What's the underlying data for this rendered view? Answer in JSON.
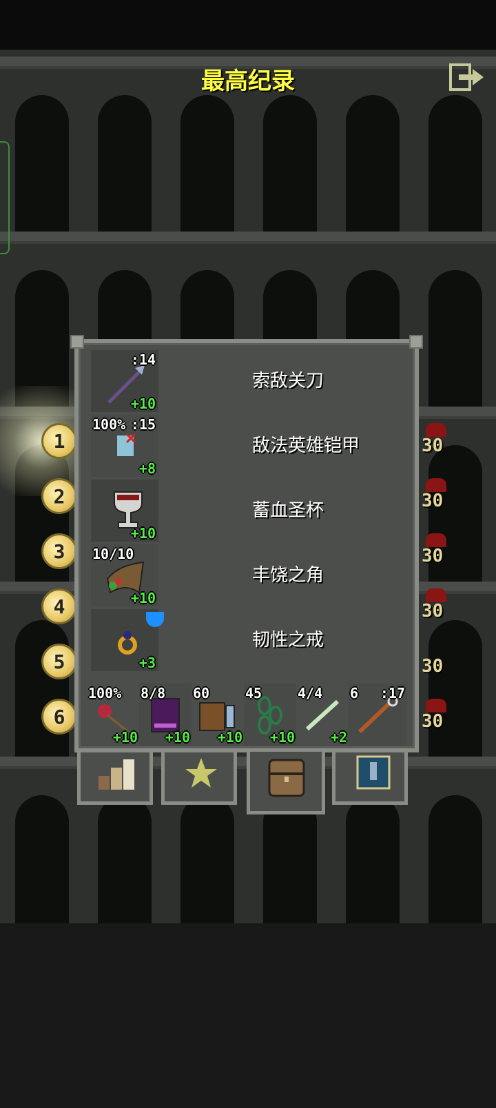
{
  "header": {
    "title": "最高纪录",
    "exit_icon": "exit-icon"
  },
  "ranks": [
    {
      "rank": "1",
      "score": "30",
      "highlight": true
    },
    {
      "rank": "2",
      "score": "30",
      "highlight": false
    },
    {
      "rank": "3",
      "score": "30",
      "highlight": false
    },
    {
      "rank": "4",
      "score": "30",
      "highlight": false
    },
    {
      "rank": "5",
      "score": "30",
      "highlight": false
    },
    {
      "rank": "6",
      "score": "30",
      "highlight": false
    }
  ],
  "equipment": {
    "weapon": {
      "name": "索敌关刀",
      "top_right": ":14",
      "upgrade": "+10",
      "icon": "glaive-icon"
    },
    "armor": {
      "name": "敌法英雄铠甲",
      "top_left": "100%",
      "top_right": ":15",
      "upgrade": "+8",
      "icon": "armor-icon"
    },
    "artifact": {
      "name": "蓄血圣杯",
      "upgrade": "+10",
      "icon": "chalice-icon"
    },
    "misc": {
      "name": "丰饶之角",
      "top_left": "10/10",
      "upgrade": "+10",
      "icon": "horn-icon"
    },
    "ring": {
      "name": "韧性之戒",
      "upgrade": "+3",
      "icon": "ring-icon"
    }
  },
  "quickslots": [
    {
      "icon": "rose-icon",
      "top_left": "100%",
      "top_right": "",
      "upgrade": "+10"
    },
    {
      "icon": "book-icon",
      "top_left": "8/8",
      "top_right": "",
      "upgrade": "+10"
    },
    {
      "icon": "chest-icon",
      "top_left": "60",
      "top_right": "",
      "upgrade": "+10"
    },
    {
      "icon": "chain-icon",
      "top_left": "45",
      "top_right": "",
      "upgrade": "+10"
    },
    {
      "icon": "wand-icon",
      "top_left": "4/4",
      "top_right": "",
      "upgrade": "+2"
    },
    {
      "icon": "staff-icon",
      "top_left": "6",
      "top_right": ":17",
      "upgrade": ""
    }
  ],
  "tabs": [
    {
      "icon": "stats-icon",
      "active": false
    },
    {
      "icon": "badge-star-icon",
      "active": false
    },
    {
      "icon": "backpack-icon",
      "active": true
    },
    {
      "icon": "journal-icon",
      "active": false
    }
  ]
}
